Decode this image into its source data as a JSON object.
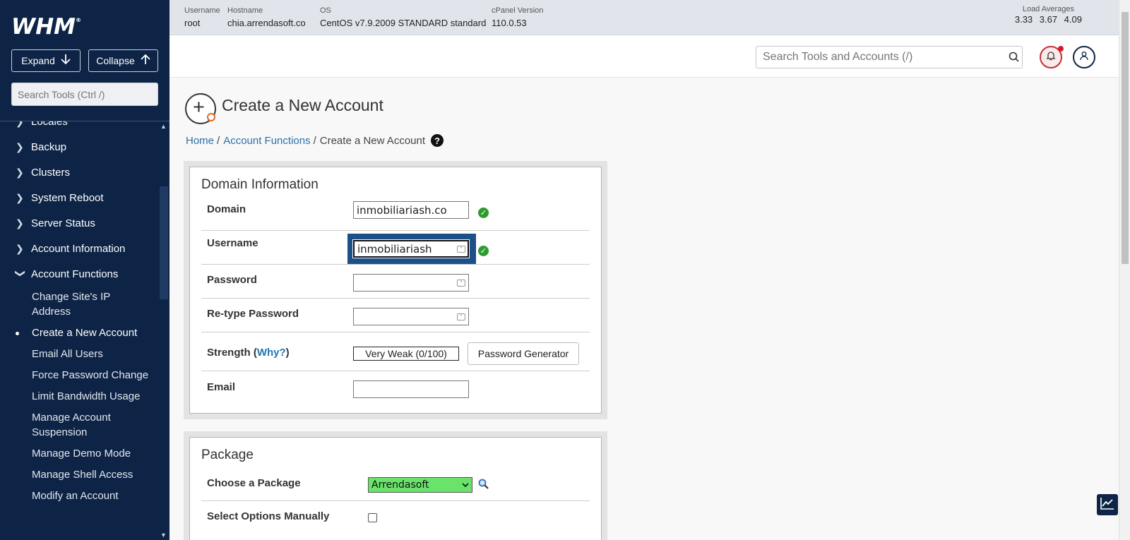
{
  "sidebar": {
    "logo": "WHM",
    "expand_label": "Expand",
    "collapse_label": "Collapse",
    "search_placeholder": "Search Tools (Ctrl /)",
    "categories": [
      {
        "label": "Locales"
      },
      {
        "label": "Backup"
      },
      {
        "label": "Clusters"
      },
      {
        "label": "System Reboot"
      },
      {
        "label": "Server Status"
      },
      {
        "label": "Account Information"
      },
      {
        "label": "Account Functions"
      }
    ],
    "account_functions": [
      {
        "label": "Change Site's IP Address"
      },
      {
        "label": "Create a New Account"
      },
      {
        "label": "Email All Users"
      },
      {
        "label": "Force Password Change"
      },
      {
        "label": "Limit Bandwidth Usage"
      },
      {
        "label": "Manage Account Suspension"
      },
      {
        "label": "Manage Demo Mode"
      },
      {
        "label": "Manage Shell Access"
      },
      {
        "label": "Modify an Account"
      }
    ]
  },
  "infobar": {
    "username_label": "Username",
    "username": "root",
    "hostname_label": "Hostname",
    "hostname": "chia.arrendasoft.co",
    "os_label": "OS",
    "os": "CentOS v7.9.2009 STANDARD standard",
    "cpanel_label": "cPanel Version",
    "cpanel": "110.0.53",
    "load_label": "Load Averages",
    "load_values": "3.33 3.67 4.09"
  },
  "header": {
    "search_placeholder": "Search Tools and Accounts (/)"
  },
  "page": {
    "title": "Create a New Account",
    "breadcrumb": {
      "home": "Home",
      "section": "Account Functions",
      "current": "Create a New Account",
      "help": "?"
    }
  },
  "domain_info": {
    "heading": "Domain Information",
    "domain_label": "Domain",
    "domain_value": "inmobiliariash.co",
    "username_label": "Username",
    "username_value": "inmobiliariash",
    "password_label": "Password",
    "password_value": "",
    "retype_label": "Re-type Password",
    "retype_value": "",
    "strength_label": "Strength (",
    "strength_why": "Why?",
    "strength_close": ")",
    "strength_value": "Very Weak (0/100)",
    "strength_score": 0,
    "pwgen_label": "Password Generator",
    "email_label": "Email",
    "email_value": ""
  },
  "package": {
    "heading": "Package",
    "choose_label": "Choose a Package",
    "choose_value": "Arrendasoft",
    "manual_label": "Select Options Manually",
    "manual_checked": false
  },
  "colors": {
    "sidebar_bg": "#0d2446",
    "link": "#2f6fa8",
    "valid_green": "#2f9b2f",
    "package_select": "#6ae36a",
    "focus_ring": "#1d5089"
  }
}
